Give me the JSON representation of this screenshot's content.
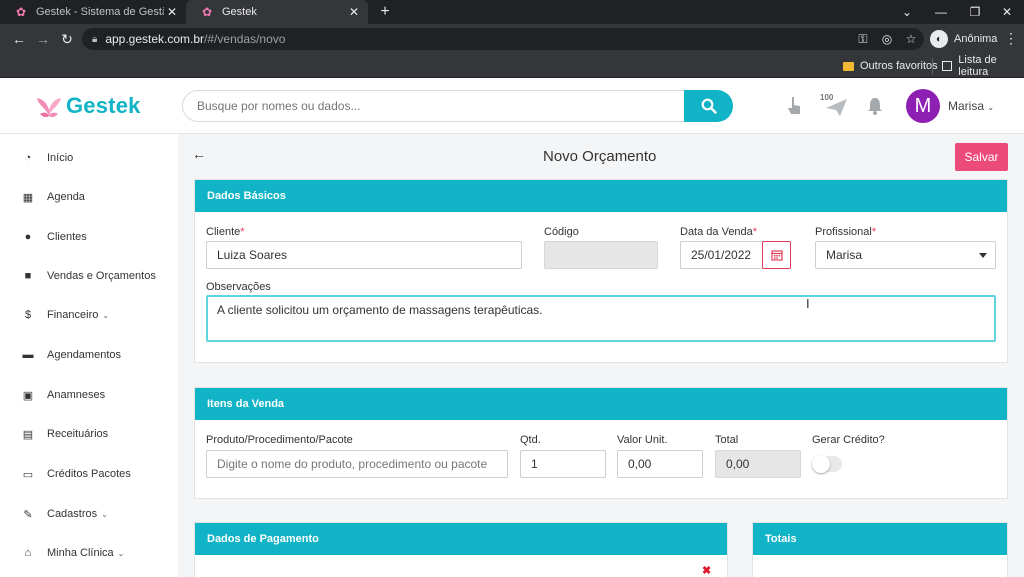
{
  "browser": {
    "tabs": [
      {
        "title": "Gestek - Sistema de Gestão para",
        "active": false
      },
      {
        "title": "Gestek",
        "active": true
      }
    ],
    "url_host": "app.gestek.com.br",
    "url_path": "/#/vendas/novo",
    "profile_label": "Anônima",
    "bookmarks": {
      "other": "Outros favoritos",
      "reading_list": "Lista de leitura"
    }
  },
  "header": {
    "brand": "Gestek",
    "search_placeholder": "Busque por nomes ou dados...",
    "notification_count": "100",
    "user_initial": "M",
    "user_name": "Marisa"
  },
  "sidebar": {
    "items": [
      {
        "label": "Início",
        "icon": "dashboard-icon"
      },
      {
        "label": "Agenda",
        "icon": "calendar-icon"
      },
      {
        "label": "Clientes",
        "icon": "users-icon"
      },
      {
        "label": "Vendas e Orçamentos",
        "icon": "shopping-bag-icon"
      },
      {
        "label": "Financeiro",
        "icon": "dollar-icon",
        "expandable": true
      },
      {
        "label": "Agendamentos",
        "icon": "calendar-filled-icon"
      },
      {
        "label": "Anamneses",
        "icon": "id-card-icon"
      },
      {
        "label": "Receituários",
        "icon": "file-icon"
      },
      {
        "label": "Créditos Pacotes",
        "icon": "receipt-icon"
      },
      {
        "label": "Cadastros",
        "icon": "edit-icon",
        "expandable": true
      },
      {
        "label": "Minha Clínica",
        "icon": "home-icon",
        "expandable": true
      }
    ]
  },
  "page": {
    "title": "Novo Orçamento",
    "save_label": "Salvar"
  },
  "basic_data": {
    "heading": "Dados Básicos",
    "client_label": "Cliente",
    "client_value": "Luiza Soares",
    "code_label": "Código",
    "code_value": "",
    "sale_date_label": "Data da Venda",
    "sale_date_value": "25/01/2022",
    "professional_label": "Profissional",
    "professional_value": "Marisa",
    "notes_label": "Observações",
    "notes_value": "A cliente solicitou um orçamento de massagens terapêuticas.",
    "required_marker": "*"
  },
  "items": {
    "heading": "Itens da Venda",
    "product_label": "Produto/Procedimento/Pacote",
    "product_placeholder": "Digite o nome do produto, procedimento ou pacote",
    "qty_label": "Qtd.",
    "qty_value": "1",
    "unit_label": "Valor Unit.",
    "unit_value": "0,00",
    "total_label": "Total",
    "total_value": "0,00",
    "credit_label": "Gerar Crédito?",
    "credit_on": false
  },
  "payment": {
    "heading": "Dados de Pagamento"
  },
  "totals": {
    "heading": "Totais"
  },
  "colors": {
    "primary": "#11b3c6",
    "save": "#ec4a7a",
    "avatar": "#8e1fb3"
  }
}
